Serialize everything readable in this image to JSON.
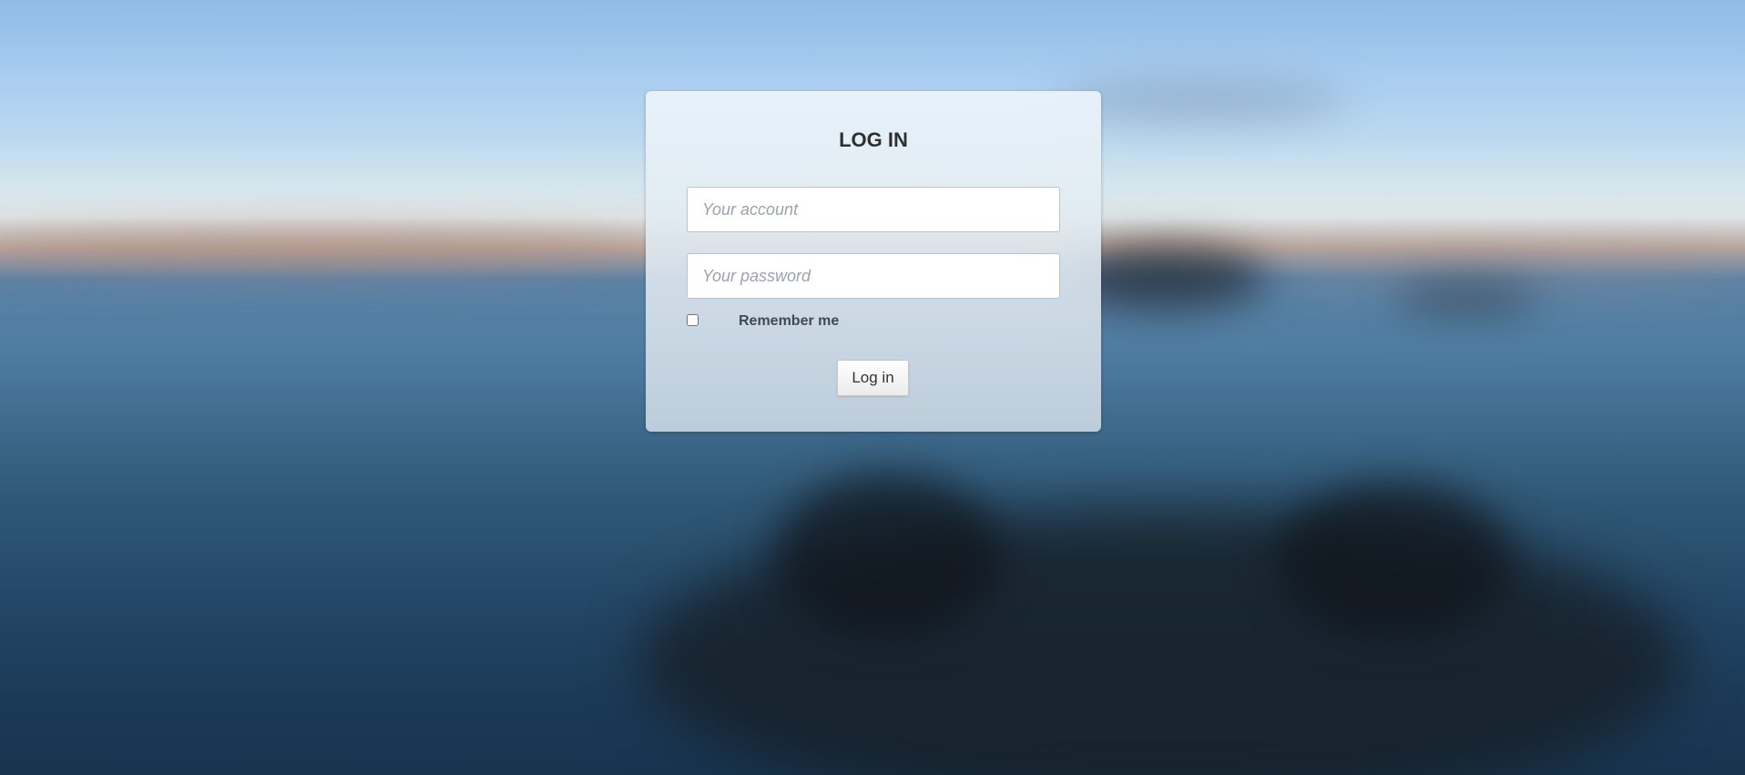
{
  "login": {
    "title": "LOG IN",
    "account_placeholder": "Your account",
    "password_placeholder": "Your password",
    "remember_label": "Remember me",
    "remember_checked": false,
    "submit_label": "Log in"
  }
}
